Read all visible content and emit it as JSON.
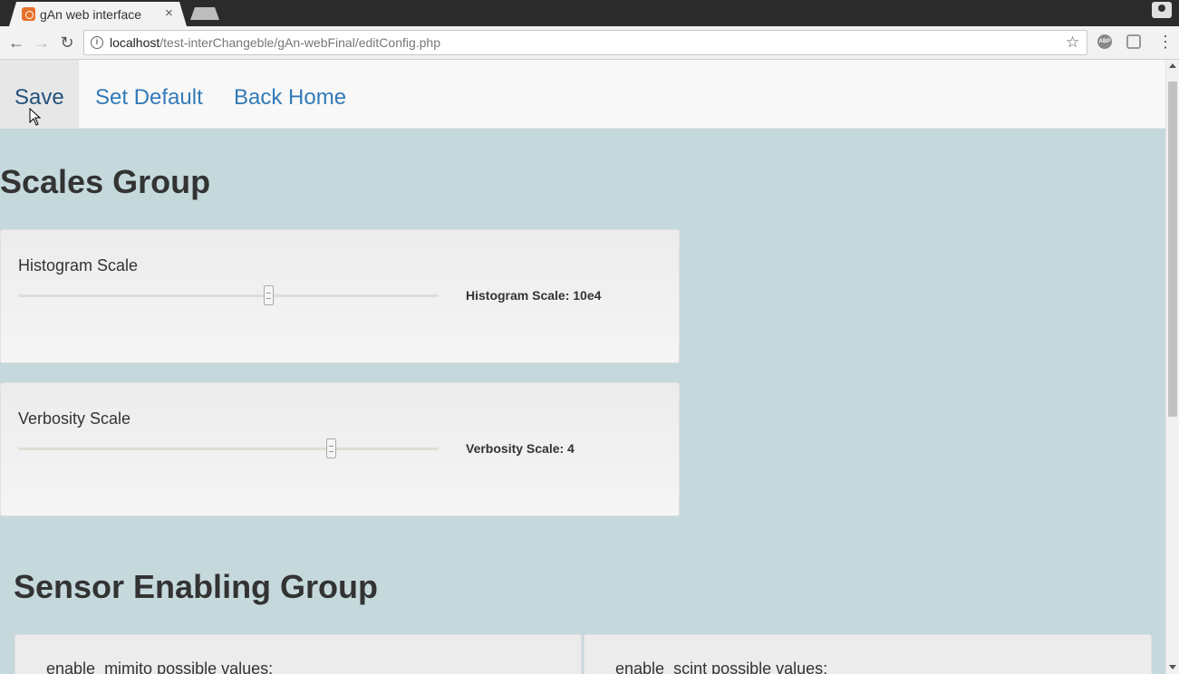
{
  "browser": {
    "tab_title": "gAn web interface",
    "tab_close": "×",
    "url_host": "localhost",
    "url_path": "/test-interChangeble/gAn-webFinal/editConfig.php",
    "ext_abp": "ABP"
  },
  "navbar": {
    "save_label": "Save",
    "set_default_label": "Set Default",
    "back_home_label": "Back Home"
  },
  "scales_group": {
    "title": "Scales Group",
    "histogram": {
      "label": "Histogram Scale",
      "readout": "Histogram Scale: 10e4",
      "slider_fraction": 0.595
    },
    "verbosity": {
      "label": "Verbosity Scale",
      "readout": "Verbosity Scale: 4",
      "slider_fraction": 0.743
    }
  },
  "sensor_group": {
    "title": "Sensor Enabling Group",
    "items": [
      {
        "label": "enable_mimito possible values:"
      },
      {
        "label": "enable_scint possible values:"
      }
    ]
  }
}
